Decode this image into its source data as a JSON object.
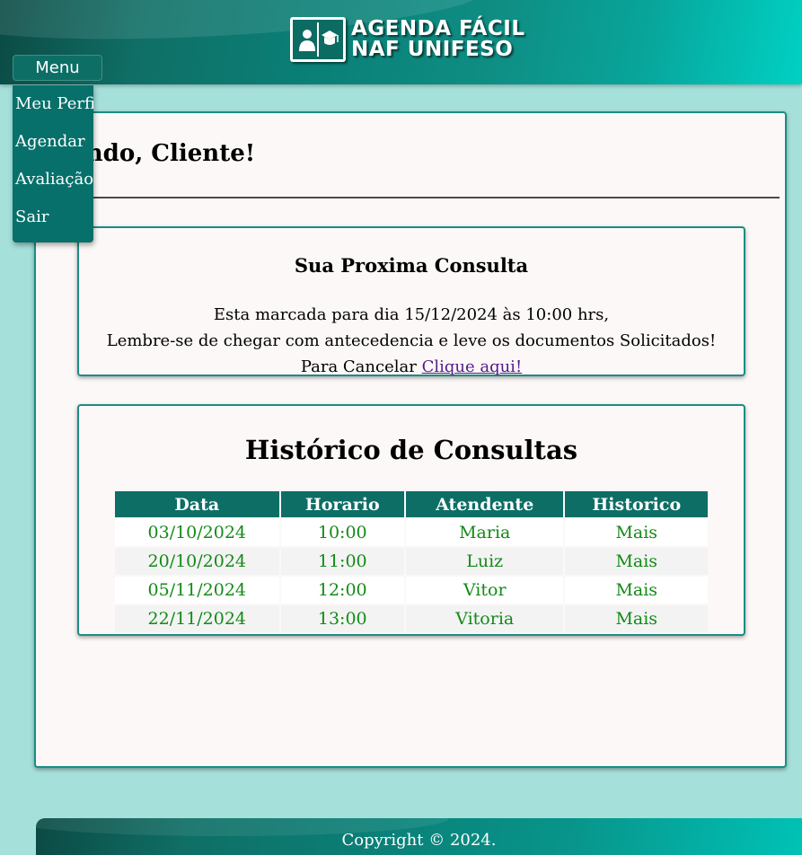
{
  "header": {
    "logo_line1": "AGENDA FÁCIL",
    "logo_line2": "NAF UNIFESO",
    "logo_icon": "book-graduate-icon"
  },
  "menu": {
    "button_label": "Menu",
    "items": [
      {
        "label": "Meu Perfil"
      },
      {
        "label": "Agendar"
      },
      {
        "label": "Avaliação"
      },
      {
        "label": "Sair"
      }
    ]
  },
  "main": {
    "welcome": "-vindo, Cliente!",
    "next_appointment": {
      "title": "Sua Proxima Consulta",
      "line1": "Esta marcada para dia 15/12/2024 às 10:00 hrs,",
      "line2": "Lembre-se de chegar com antecedencia e leve os documentos Solicitados!",
      "cancel_prefix": "Para Cancelar ",
      "cancel_link": "Clique aqui!"
    },
    "history": {
      "title": "Histórico de Consultas",
      "columns": [
        "Data",
        "Horario",
        "Atendente",
        "Historico"
      ],
      "rows": [
        [
          "03/10/2024",
          "10:00",
          "Maria",
          "Mais"
        ],
        [
          "20/10/2024",
          "11:00",
          "Luiz",
          "Mais"
        ],
        [
          "05/11/2024",
          "12:00",
          "Vitor",
          "Mais"
        ],
        [
          "22/11/2024",
          "13:00",
          "Vitoria",
          "Mais"
        ]
      ]
    }
  },
  "footer": {
    "copyright": "Copyright © 2024."
  },
  "colors": {
    "teal_dark": "#0d6e66",
    "background": "#a6e0da",
    "panel": "#fcf8f7",
    "table_text": "#138a16",
    "link": "#551a8b"
  }
}
